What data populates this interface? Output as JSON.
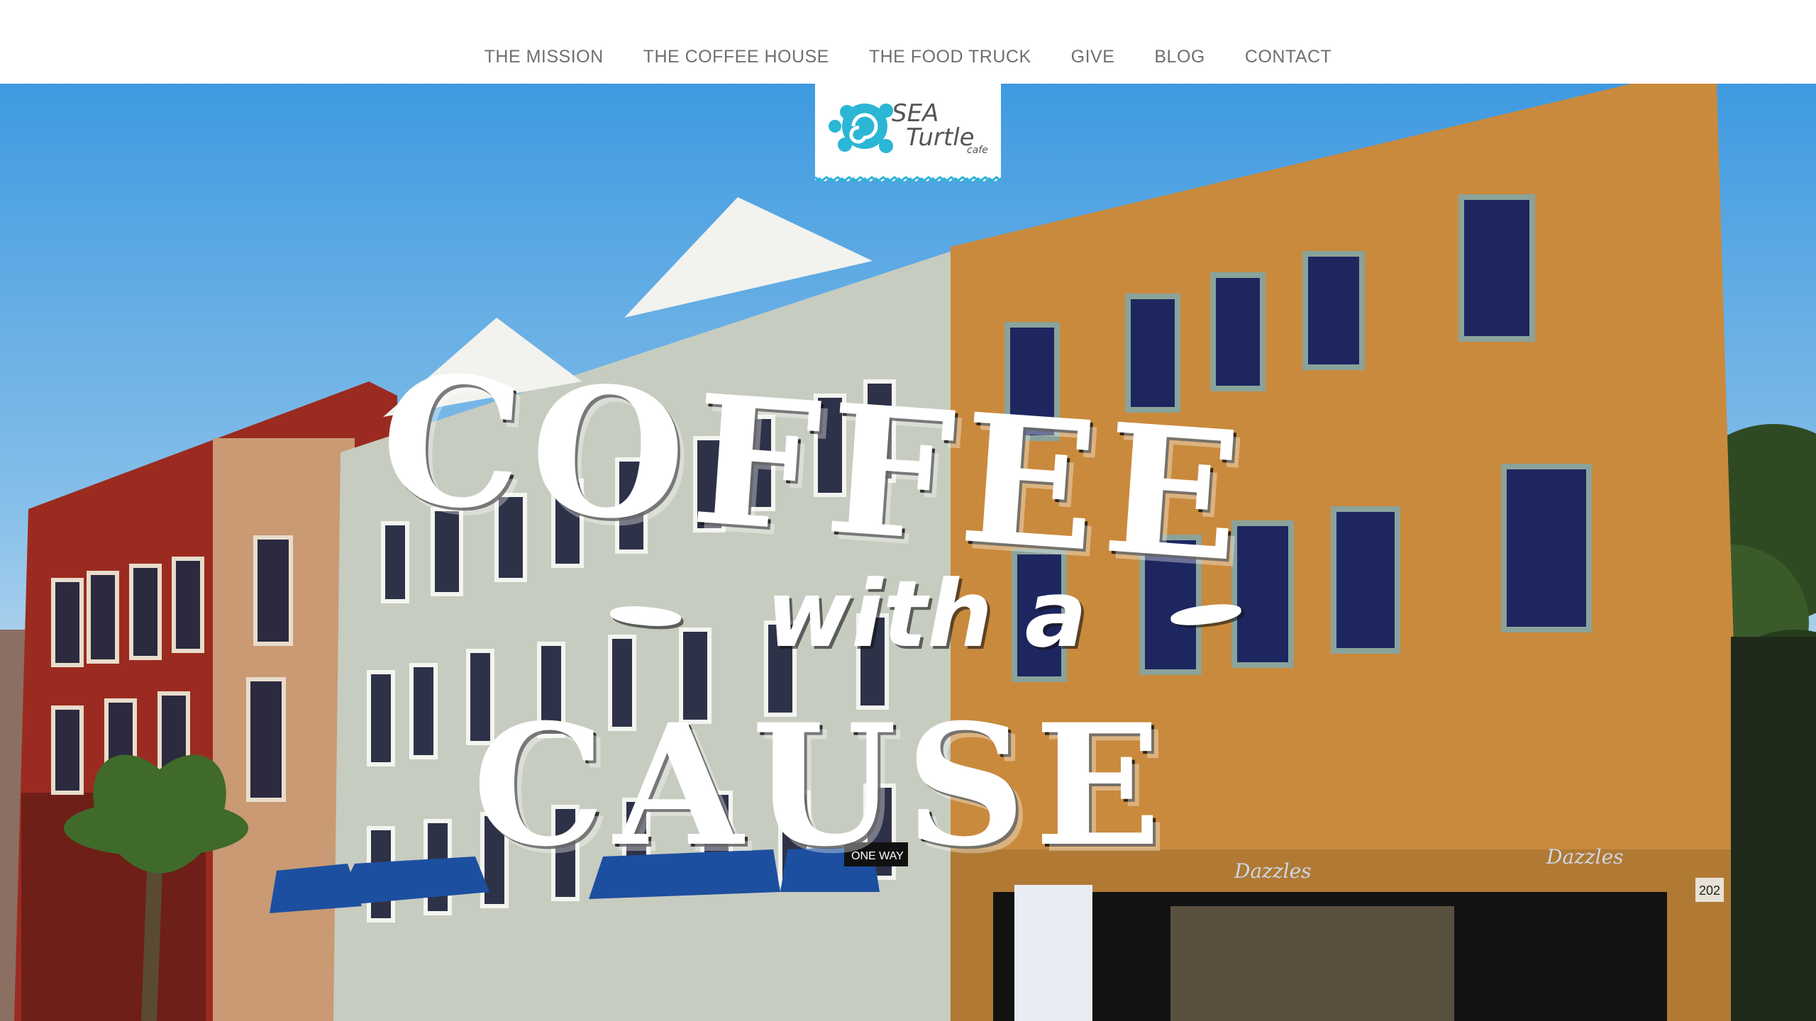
{
  "nav": {
    "items": [
      {
        "label": "THE MISSION"
      },
      {
        "label": "THE COFFEE HOUSE"
      },
      {
        "label": "THE FOOD TRUCK"
      },
      {
        "label": "GIVE"
      },
      {
        "label": "BLOG"
      },
      {
        "label": "CONTACT"
      }
    ]
  },
  "logo": {
    "line1": "SEA",
    "line2": "Turtle",
    "line3": "cafe",
    "icon": "turtle-icon",
    "color": "#2bb6d6"
  },
  "hero": {
    "headline_top": "COFFEE",
    "headline_middle": "with a",
    "headline_bottom": "CAUSE",
    "signs": {
      "one_way": "ONE WAY",
      "store_name": "Dazzles",
      "address": "202"
    }
  },
  "colors": {
    "nav_text": "#6f6f6f",
    "sky": "#4fa3e0",
    "brick_red": "#9b2b20",
    "stone": "#c9cec2",
    "yellow_brick": "#c98a3d",
    "awning": "#1d4fa0"
  }
}
